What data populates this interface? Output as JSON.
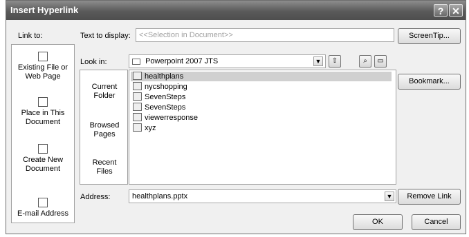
{
  "title": "Insert Hyperlink",
  "titlebar": {
    "help_glyph": "?",
    "close_glyph": "✕"
  },
  "link_to": {
    "label": "Link to:",
    "items": [
      {
        "line1": "Existing File or",
        "line2": "Web Page",
        "icon": "file-icon"
      },
      {
        "line1": "Place in This",
        "line2": "Document",
        "icon": "document-icon"
      },
      {
        "line1": "Create New",
        "line2": "Document",
        "icon": "new-document-icon"
      },
      {
        "line1": "E-mail Address",
        "line2": "",
        "icon": "email-icon"
      }
    ]
  },
  "text_to_display": {
    "label": "Text to display:",
    "value": "<<Selection in Document>>"
  },
  "screentip_label": "ScreenTip...",
  "look_in": {
    "label": "Look in:",
    "value": "Powerpoint 2007 JTS"
  },
  "folder_tabs": [
    {
      "line1": "Current",
      "line2": "Folder"
    },
    {
      "line1": "Browsed",
      "line2": "Pages"
    },
    {
      "line1": "Recent",
      "line2": "Files"
    }
  ],
  "files": [
    "healthplans",
    "nycshopping",
    "SevenSteps",
    "SevenSteps",
    "viewerresponse",
    "xyz"
  ],
  "selected_file_index": 0,
  "bookmark_label": "Bookmark...",
  "address": {
    "label": "Address:",
    "value": "healthplans.pptx"
  },
  "remove_link_label": "Remove Link",
  "ok_label": "OK",
  "cancel_label": "Cancel"
}
